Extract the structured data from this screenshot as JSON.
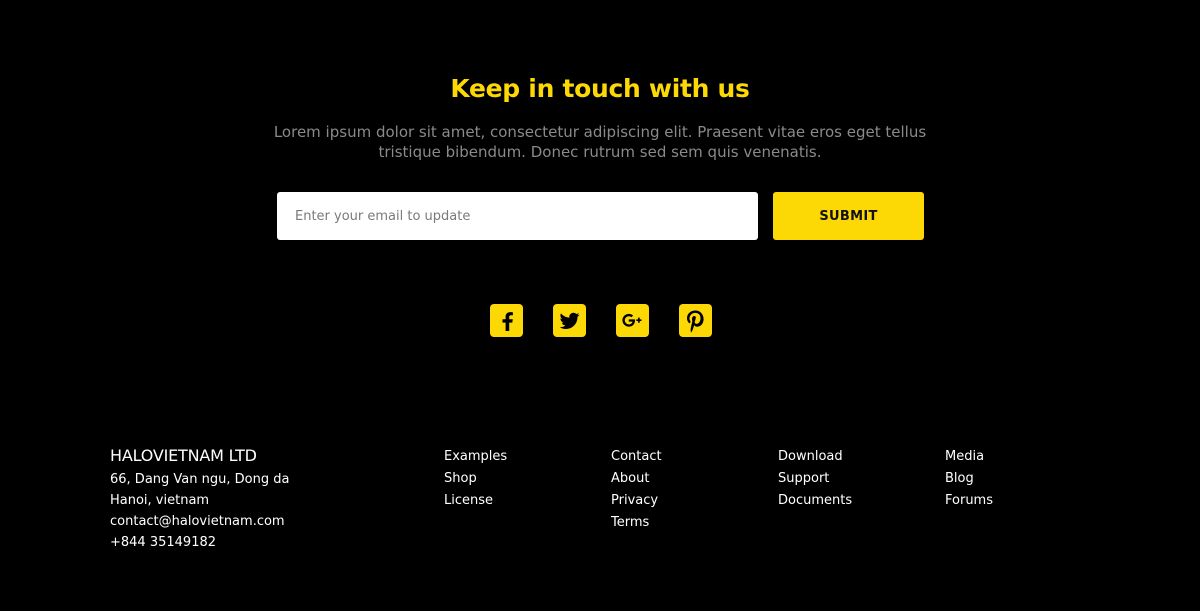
{
  "newsletter": {
    "title": "Keep in touch with us",
    "description": "Lorem ipsum dolor sit amet, consectetur adipiscing elit. Praesent vitae eros eget tellus tristique bibendum. Donec rutrum sed sem quis venenatis.",
    "email_placeholder": "Enter your email to update",
    "email_value": "",
    "submit_label": "SUBMIT"
  },
  "social": [
    {
      "icon": "facebook-icon"
    },
    {
      "icon": "twitter-icon"
    },
    {
      "icon": "google-plus-icon"
    },
    {
      "icon": "pinterest-icon"
    }
  ],
  "company": {
    "name": "HALOVIETNAM LTD",
    "address_line1": "66, Dang Van ngu, Dong da",
    "address_line2": "Hanoi, vietnam",
    "email": "contact@halovietnam.com",
    "phone": "+844 35149182"
  },
  "links": {
    "col1": [
      "Examples",
      "Shop",
      "License"
    ],
    "col2": [
      "Contact",
      "About",
      "Privacy",
      "Terms"
    ],
    "col3": [
      "Download",
      "Support",
      "Documents"
    ],
    "col4": [
      "Media",
      "Blog",
      "Forums"
    ]
  },
  "colors": {
    "background": "#000000",
    "accent": "#fcd804",
    "muted_text": "#8a8a8a",
    "text": "#ffffff"
  }
}
